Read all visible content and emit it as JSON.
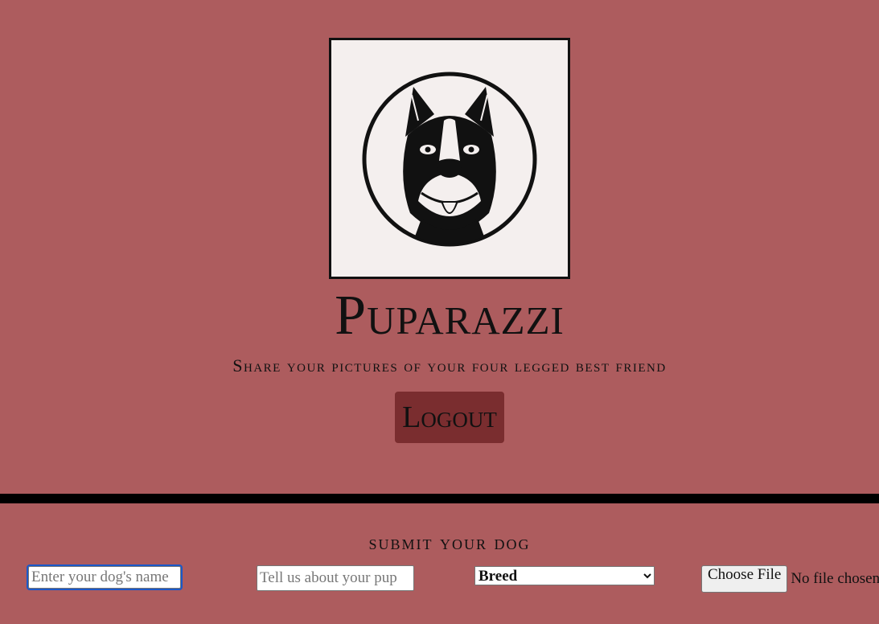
{
  "header": {
    "title": "Puparazzi",
    "tagline": "Share your pictures of your four legged best friend",
    "logout_label": "Logout"
  },
  "form": {
    "heading": "submit your dog",
    "name_placeholder": "Enter your dog's name",
    "about_placeholder": "Tell us about your pup",
    "breed_selected": "Breed",
    "file_button_label": "Choose File",
    "file_status": "No file chosen"
  },
  "icons": {
    "logo": "dog-face-icon"
  },
  "colors": {
    "background": "#ad5c5e",
    "logout_button": "#7a2d2f",
    "divider": "#000000",
    "logo_background": "#f4efee"
  }
}
